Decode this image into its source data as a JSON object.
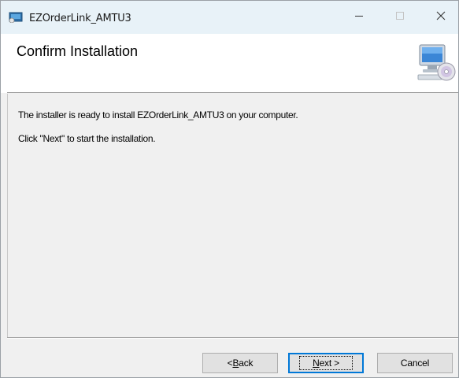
{
  "window": {
    "title": "EZOrderLink_AMTU3",
    "icons": {
      "app": "installer-app-icon",
      "minimize": "minimize-icon",
      "maximize": "maximize-icon",
      "close": "close-icon"
    }
  },
  "banner": {
    "title": "Confirm Installation",
    "icon": "computer-cd-icon"
  },
  "content": {
    "line1": "The installer is ready to install EZOrderLink_AMTU3 on your computer.",
    "line2": "Click \"Next\" to start the installation."
  },
  "buttons": {
    "back": {
      "prefix": "< ",
      "mnemonic": "B",
      "rest": "ack"
    },
    "next": {
      "mnemonic": "N",
      "rest": "ext >"
    },
    "cancel": "Cancel"
  }
}
